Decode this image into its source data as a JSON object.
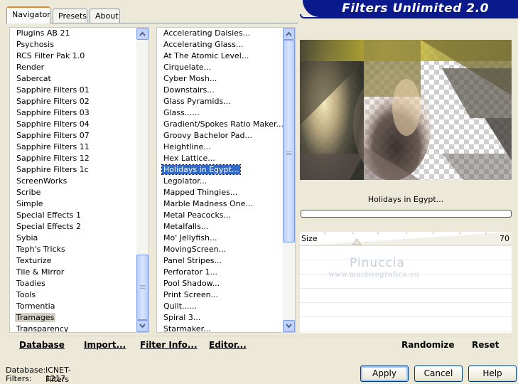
{
  "header": {
    "title": "Filters Unlimited 2.0"
  },
  "tabs": [
    "Navigator",
    "Presets",
    "About"
  ],
  "categories": [
    "Plugins AB 21",
    "Psychosis",
    "RCS Filter Pak 1.0",
    "Render",
    "Sabercat",
    "Sapphire Filters 01",
    "Sapphire Filters 02",
    "Sapphire Filters 03",
    "Sapphire Filters 04",
    "Sapphire Filters 07",
    "Sapphire Filters 11",
    "Sapphire Filters 12",
    "Sapphire Filters 1c",
    "ScreenWorks",
    "Scribe",
    "Simple",
    "Special Effects 1",
    "Special Effects 2",
    "Sybia",
    "Teph's Tricks",
    "Texturize",
    "Tile & Mirror",
    "Toadies",
    "Tools",
    "Tormentia",
    "Tramages",
    "Transparency"
  ],
  "selected_category": "Tramages",
  "filters": [
    "Accelerating Daisies...",
    "Accelerating Glass...",
    "At The Atomic Level...",
    "Cirquelate...",
    "Cyber Mosh...",
    "Downstairs...",
    "Glass Pyramids...",
    "Glass......",
    "Gradient/Spokes Ratio Maker...",
    "Groovy Bachelor Pad...",
    "Heightline...",
    "Hex Lattice...",
    "Holidays in Egypt...",
    "Legolator...",
    "Mapped Thingies...",
    "Marble Madness One...",
    "Metal Peacocks...",
    "Metalfalls...",
    "Mo' Jellyfish...",
    "MovingScreen...",
    "Panel Stripes...",
    "Perforator 1...",
    "Pool Shadow...",
    "Print Screen...",
    "Quilt......",
    "Spiral 3...",
    "Starmaker..."
  ],
  "selected_filter": "Holidays in Egypt...",
  "preview": {
    "filter_name": "Holidays in Egypt...",
    "progress": 0
  },
  "controls": {
    "slider_label": "Size",
    "slider_value": "70",
    "slider_max": 255
  },
  "watermark": {
    "line1": "Pinuccia",
    "line2": "www.maidiregrafica.eu"
  },
  "left_actions": {
    "database": "Database",
    "import": "Import...",
    "filter_info": "Filter Info...",
    "editor": "Editor..."
  },
  "right_actions": {
    "randomize": "Randomize",
    "reset": "Reset"
  },
  "status": {
    "database_label": "Database:",
    "database_value": "ICNET-Filters",
    "filters_label": "Filters:",
    "filters_value": "1217"
  },
  "dialog_buttons": {
    "apply": "Apply",
    "cancel": "Cancel",
    "help": "Help"
  }
}
